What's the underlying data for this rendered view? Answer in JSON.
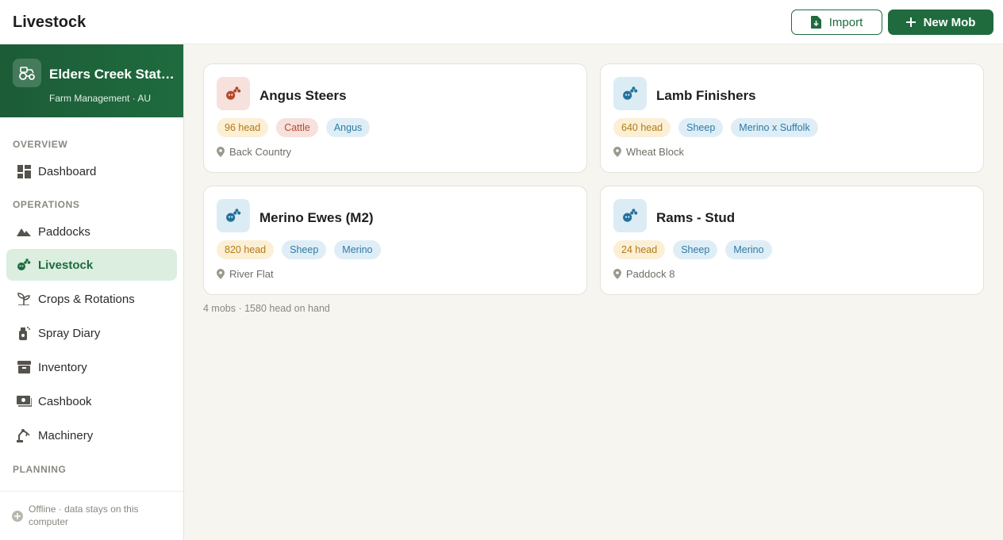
{
  "header": {
    "title": "Livestock",
    "import_label": "Import",
    "new_label": "New Mob"
  },
  "farm": {
    "name": "Elders Creek Station",
    "subtitle": "Farm Management · AU"
  },
  "sidebar": {
    "sections": [
      {
        "label": "OVERVIEW"
      },
      {
        "label": "OPERATIONS"
      },
      {
        "label": "PLANNING"
      }
    ],
    "items": [
      {
        "label": "Dashboard",
        "icon": "dashboard-icon"
      },
      {
        "label": "Paddocks",
        "icon": "mountain-icon"
      },
      {
        "label": "Livestock",
        "icon": "livestock-icon",
        "active": true
      },
      {
        "label": "Crops & Rotations",
        "icon": "seedling-icon"
      },
      {
        "label": "Spray Diary",
        "icon": "spray-icon"
      },
      {
        "label": "Inventory",
        "icon": "archive-box-icon"
      },
      {
        "label": "Cashbook",
        "icon": "cash-icon"
      },
      {
        "label": "Machinery",
        "icon": "robot-arm-icon"
      }
    ],
    "footer": "Offline · data stays on this computer"
  },
  "mobs": [
    {
      "name": "Angus Steers",
      "head": "96 head",
      "species": "Cattle",
      "breed": "Angus",
      "location": "Back Country"
    },
    {
      "name": "Lamb Finishers",
      "head": "640 head",
      "species": "Sheep",
      "breed": "Merino x Suffolk",
      "location": "Wheat Block"
    },
    {
      "name": "Merino Ewes (M2)",
      "head": "820 head",
      "species": "Sheep",
      "breed": "Merino",
      "location": "River Flat"
    },
    {
      "name": "Rams - Stud",
      "head": "24 head",
      "species": "Sheep",
      "breed": "Merino",
      "location": "Paddock 8"
    }
  ],
  "summary": "4 mobs · 1580 head on hand",
  "colors": {
    "brand": "#1f6b3e",
    "active_bg": "#dbeee0",
    "head_tag": "#b57a13",
    "cattle_tag": "#b54a2d",
    "sheep_tag": "#2b7aa6"
  }
}
